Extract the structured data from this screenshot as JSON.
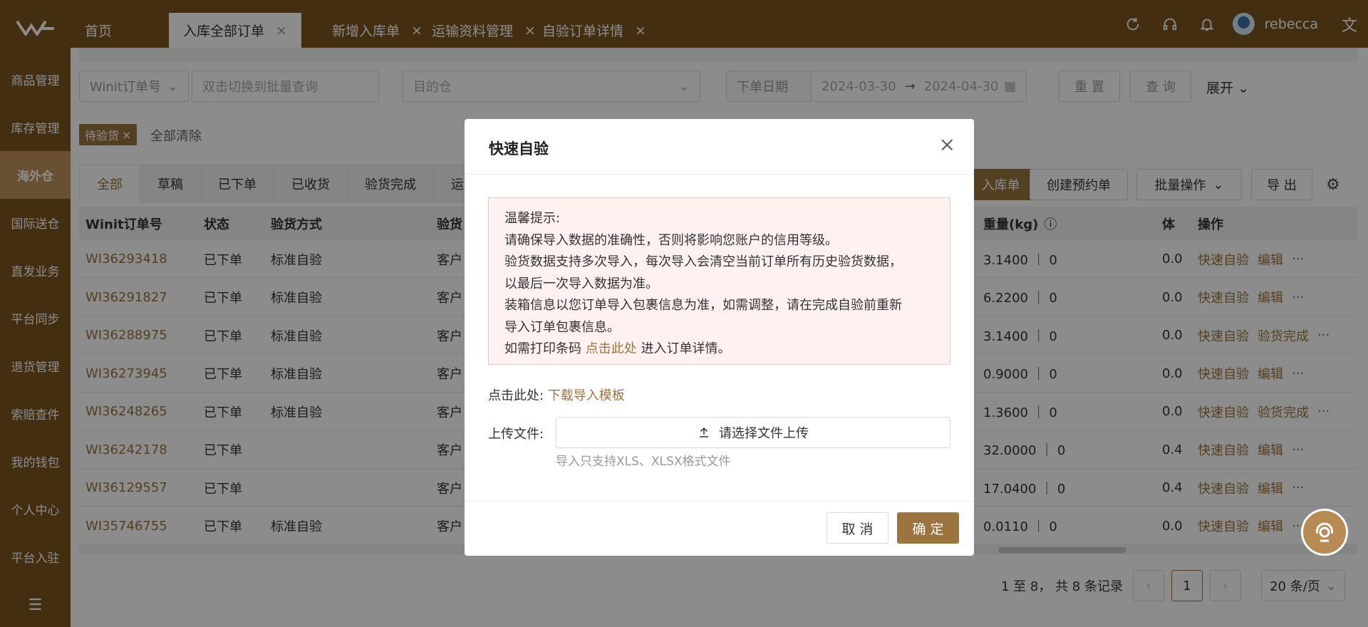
{
  "sidebar": {
    "logo": "logo-icon",
    "items": [
      {
        "label": "商品管理"
      },
      {
        "label": "库存管理"
      },
      {
        "label": "海外仓",
        "active": true
      },
      {
        "label": "国际送仓"
      },
      {
        "label": "直发业务"
      },
      {
        "label": "平台同步"
      },
      {
        "label": "退货管理"
      },
      {
        "label": "索赔查件"
      },
      {
        "label": "我的钱包"
      },
      {
        "label": "个人中心"
      },
      {
        "label": "平台入驻"
      }
    ],
    "collapse_icon": "menu-collapse-icon"
  },
  "tabs": [
    {
      "label": "首页"
    },
    {
      "label": "入库全部订单",
      "active": true
    },
    {
      "label": "新增入库单"
    },
    {
      "label": "运输资料管理"
    },
    {
      "label": "自验订单详情"
    }
  ],
  "header": {
    "username": "rebecca",
    "icons": [
      "refresh-icon",
      "headset-icon",
      "bell-icon",
      "translate-icon"
    ]
  },
  "filters": {
    "order_type": "Winit订单号",
    "batch_placeholder": "双击切换到批量查询",
    "warehouse_placeholder": "目的仓",
    "date_label": "下单日期",
    "date_start": "2024-03-30",
    "date_arrow": "→",
    "date_end": "2024-04-30",
    "reset_label": "重 置",
    "query_label": "查 询",
    "expand_label": "展开"
  },
  "active_filter": {
    "chip": "待验货",
    "clear": "全部清除"
  },
  "status_tabs": [
    "全部",
    "草稿",
    "已下单",
    "已收货",
    "验货完成",
    "运"
  ],
  "actions": {
    "inbound_partial": "入库单",
    "create_appointment": "创建预约单",
    "batch_ops": "批量操作",
    "export": "导 出"
  },
  "table": {
    "headers": [
      "Winit订单号",
      "状态",
      "验货方式",
      "验货",
      "重量(kg)",
      "体",
      "操作"
    ],
    "rows": [
      {
        "order": "WI36293418",
        "status": "已下单",
        "method": "标准自验",
        "check": "客户",
        "weight": "3.1400 ｜ 0",
        "vol": "0.0",
        "ops": [
          "快速自验",
          "编辑"
        ]
      },
      {
        "order": "WI36291827",
        "status": "已下单",
        "method": "标准自验",
        "check": "客户",
        "weight": "6.2200 ｜ 0",
        "vol": "0.0",
        "ops": [
          "快速自验",
          "编辑"
        ]
      },
      {
        "order": "WI36288975",
        "status": "已下单",
        "method": "标准自验",
        "check": "客户",
        "weight": "3.1400 ｜ 0",
        "vol": "0.0",
        "ops": [
          "快速自验",
          "验货完成"
        ]
      },
      {
        "order": "WI36273945",
        "status": "已下单",
        "method": "标准自验",
        "check": "客户",
        "weight": "0.9000 ｜ 0",
        "vol": "0.0",
        "ops": [
          "快速自验",
          "编辑"
        ]
      },
      {
        "order": "WI36248265",
        "status": "已下单",
        "method": "标准自验",
        "check": "客户",
        "weight": "1.3600 ｜ 0",
        "vol": "0.0",
        "ops": [
          "快速自验",
          "验货完成"
        ]
      },
      {
        "order": "WI36242178",
        "status": "已下单",
        "method": "",
        "check": "客户",
        "weight": "32.0000 ｜ 0",
        "vol": "0.4",
        "ops": [
          "快速自验",
          "编辑"
        ]
      },
      {
        "order": "WI36129557",
        "status": "已下单",
        "method": "",
        "check": "客户",
        "weight": "17.0400 ｜ 0",
        "vol": "0.4",
        "ops": [
          "快速自验",
          "编辑"
        ]
      },
      {
        "order": "WI35746755",
        "status": "已下单",
        "method": "标准自验",
        "check": "客户",
        "weight": "0.0110 ｜ 0",
        "vol": "0.0",
        "ops": [
          "快速自验",
          "编辑"
        ]
      }
    ],
    "more": "···"
  },
  "pagination": {
    "summary": "1 至 8， 共 8 条记录",
    "current": "1",
    "page_size": "20 条/页"
  },
  "modal": {
    "title": "快速自验",
    "warning_lines": [
      "温馨提示:",
      "请确保导入数据的准确性，否则将影响您账户的信用等级。",
      "验货数据支持多次导入，每次导入会清空当前订单所有历史验货数据，",
      "以最后一次导入数据为准。",
      "装箱信息以您订单导入包裹信息为准，如需调整，请在完成自验前重新",
      "导入订单包裹信息。"
    ],
    "print_prefix": "如需打印条码",
    "print_link": "点击此处",
    "print_suffix": "进入订单详情。",
    "template_label": "点击此处:",
    "template_link": "下载导入模板",
    "upload_label": "上传文件:",
    "upload_button": "请选择文件上传",
    "upload_hint": "导入只支持XLS、XLSX格式文件",
    "cancel": "取 消",
    "confirm": "确 定"
  },
  "colors": {
    "brand": "#7b5422",
    "accent": "#9c7440",
    "active_sidebar": "#bf9361",
    "warning_bg": "#fff1f0"
  }
}
